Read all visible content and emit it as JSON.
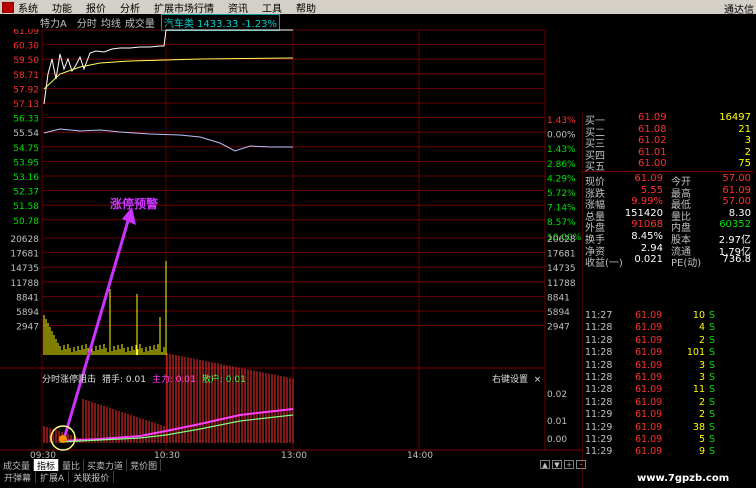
{
  "menu": {
    "items": [
      "系统",
      "功能",
      "报价",
      "分析",
      "扩展市场行情",
      "资讯",
      "工具",
      "帮助"
    ],
    "brand": "通达信"
  },
  "chart_header": {
    "stock": "特力A",
    "tab_time": "分时",
    "tab_avg": "均线",
    "tab_vol": "成交量",
    "index_name": "汽车类",
    "index_value": "1433.33",
    "index_change": "-1.23%"
  },
  "price_axis": [
    "61.09",
    "60.30",
    "59.50",
    "58.71",
    "57.92",
    "57.13",
    "56.33",
    "55.54",
    "54.75",
    "53.95",
    "53.16",
    "52.37",
    "51.58",
    "50.78"
  ],
  "pct_axis": [
    "1.43%",
    "0.00%",
    "1.43%",
    "2.86%",
    "4.29%",
    "5.72%",
    "7.14%",
    "8.57%",
    "10.00%"
  ],
  "vol_axis": [
    "20628",
    "17681",
    "14735",
    "11788",
    "8841",
    "5894",
    "2947"
  ],
  "sub_axis": [
    "0.02",
    "0.01",
    "0.00"
  ],
  "time_axis": [
    "09:30",
    "10:30",
    "13:00",
    "14:00"
  ],
  "annotation": "涨停预警",
  "sub_header": {
    "name": "分时涨停阻击",
    "catcher": "猎手: 0.01",
    "main": "主力: 0.01",
    "retail": "散户: 0.01",
    "settings": "右键设置",
    "close": "×"
  },
  "bottom_tabs": [
    "成交量",
    "指标",
    "量比",
    "买卖力道",
    "竞价图"
  ],
  "bottom_tabs2": [
    "开弹幕",
    "扩展A",
    "关联报价"
  ],
  "mini_buttons": [
    "▲",
    "▼",
    "+",
    "-"
  ],
  "order_book": [
    {
      "label": "买一",
      "price": "61.09",
      "vol": "16497"
    },
    {
      "label": "买二",
      "price": "61.08",
      "vol": "21"
    },
    {
      "label": "买三",
      "price": "61.02",
      "vol": "3"
    },
    {
      "label": "买四",
      "price": "61.01",
      "vol": "2"
    },
    {
      "label": "买五",
      "price": "61.00",
      "vol": "75"
    }
  ],
  "stats": [
    {
      "l1": "现价",
      "v1": "61.09",
      "l2": "今开",
      "v2": "57.00"
    },
    {
      "l1": "涨跌",
      "v1": "5.55",
      "l2": "最高",
      "v2": "61.09"
    },
    {
      "l1": "涨幅",
      "v1": "9.99%",
      "l2": "最低",
      "v2": "57.00"
    },
    {
      "l1": "总量",
      "v1": "151420",
      "l2": "量比",
      "v2": "8.30"
    },
    {
      "l1": "外盘",
      "v1": "91068",
      "l2": "内盘",
      "v2": "60352"
    },
    {
      "l1": "换手",
      "v1": "8.45%",
      "l2": "股本",
      "v2": "2.97亿"
    },
    {
      "l1": "净资",
      "v1": "2.94",
      "l2": "流通",
      "v2": "1.79亿"
    },
    {
      "l1": "收益(一)",
      "v1": "0.021",
      "l2": "PE(动)",
      "v2": "736.8"
    }
  ],
  "ticks": [
    {
      "time": "11:27",
      "price": "61.09",
      "vol": "10",
      "side": "S"
    },
    {
      "time": "11:28",
      "price": "61.09",
      "vol": "4",
      "side": "S"
    },
    {
      "time": "11:28",
      "price": "61.09",
      "vol": "2",
      "side": "S"
    },
    {
      "time": "11:28",
      "price": "61.09",
      "vol": "101",
      "side": "S"
    },
    {
      "time": "11:28",
      "price": "61.09",
      "vol": "3",
      "side": "S"
    },
    {
      "time": "11:28",
      "price": "61.09",
      "vol": "3",
      "side": "S"
    },
    {
      "time": "11:28",
      "price": "61.09",
      "vol": "11",
      "side": "S"
    },
    {
      "time": "11:28",
      "price": "61.09",
      "vol": "2",
      "side": "S"
    },
    {
      "time": "11:29",
      "price": "61.09",
      "vol": "2",
      "side": "S"
    },
    {
      "time": "11:29",
      "price": "61.09",
      "vol": "38",
      "side": "S"
    },
    {
      "time": "11:29",
      "price": "61.09",
      "vol": "5",
      "side": "S"
    },
    {
      "time": "11:29",
      "price": "61.09",
      "vol": "9",
      "side": "S"
    }
  ],
  "watermark": "www.7gpzb.com",
  "colors": {
    "up": "#ff3030",
    "down": "#00e000",
    "grid": "#800000",
    "label": "#c0c0c0",
    "yellow": "#ffff00",
    "cyan": "#00d0d0",
    "magenta": "#cc33ff"
  }
}
